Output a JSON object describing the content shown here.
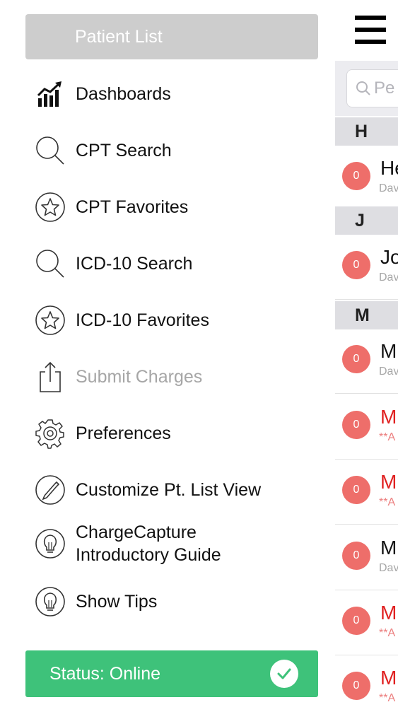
{
  "drawer": {
    "patient_list_button": "Patient List",
    "menu": [
      {
        "label": "Dashboards",
        "icon": "chart-bars-icon",
        "enabled": true
      },
      {
        "label": "CPT Search",
        "icon": "search-icon",
        "enabled": true
      },
      {
        "label": "CPT Favorites",
        "icon": "star-circle-icon",
        "enabled": true
      },
      {
        "label": "ICD-10 Search",
        "icon": "search-icon",
        "enabled": true
      },
      {
        "label": "ICD-10 Favorites",
        "icon": "star-circle-icon",
        "enabled": true
      },
      {
        "label": "Submit Charges",
        "icon": "share-upload-icon",
        "enabled": false
      },
      {
        "label": "Preferences",
        "icon": "gear-icon",
        "enabled": true
      },
      {
        "label": "Customize Pt. List View",
        "icon": "pencil-circle-icon",
        "enabled": true
      },
      {
        "label": "ChargeCapture\nIntroductory Guide",
        "icon": "lightbulb-circle-icon",
        "enabled": true
      },
      {
        "label": "Show Tips",
        "icon": "lightbulb-circle-icon",
        "enabled": true
      }
    ],
    "status": {
      "label": "Status: Online",
      "icon": "checkmark-circle-icon",
      "color": "#3ec27a"
    }
  },
  "patient_list": {
    "search_placeholder": "Pe",
    "sections": [
      {
        "letter": "H",
        "rows": [
          {
            "badge": "0",
            "name": "He",
            "sub": "Dav",
            "alert": false
          }
        ]
      },
      {
        "letter": "J",
        "rows": [
          {
            "badge": "0",
            "name": "Jo",
            "sub": "Dav",
            "alert": false
          }
        ]
      },
      {
        "letter": "M",
        "rows": [
          {
            "badge": "0",
            "name": "M",
            "sub": "Dav",
            "alert": false
          },
          {
            "badge": "0",
            "name": "M",
            "sub": "**A",
            "alert": true
          },
          {
            "badge": "0",
            "name": "M",
            "sub": "**A",
            "alert": true
          },
          {
            "badge": "0",
            "name": "M",
            "sub": "Dav",
            "alert": false
          },
          {
            "badge": "0",
            "name": "M",
            "sub": "**A",
            "alert": true
          },
          {
            "badge": "0",
            "name": "M",
            "sub": "**A",
            "alert": true
          }
        ]
      }
    ]
  },
  "colors": {
    "accent_green": "#3ec27a",
    "badge_red": "#ee6e6a",
    "alert_red": "#e02020",
    "disabled_gray": "#a6a6a6"
  }
}
